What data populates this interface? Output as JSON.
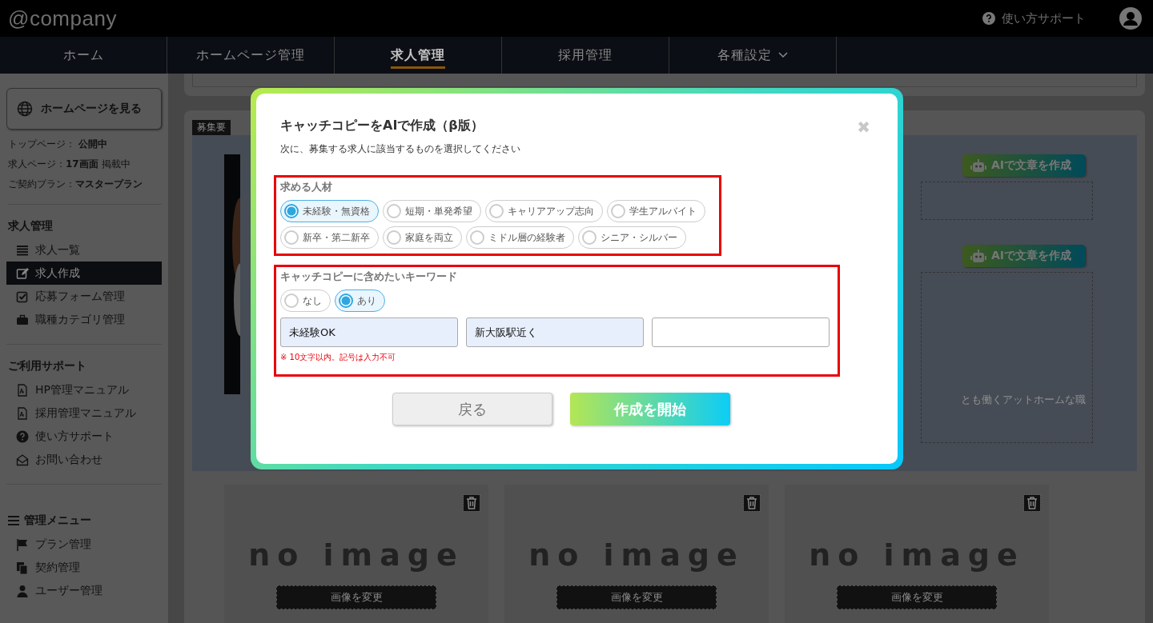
{
  "header": {
    "logo": "@company",
    "help_link": "使い方サポート"
  },
  "nav": {
    "tabs": [
      {
        "label": "ホーム",
        "selected": false
      },
      {
        "label": "ホームページ管理",
        "selected": false
      },
      {
        "label": "求人管理",
        "selected": true
      },
      {
        "label": "採用管理",
        "selected": false
      },
      {
        "label": "各種設定",
        "selected": false,
        "dropdown": true
      }
    ]
  },
  "sidebar": {
    "view_site_button": "ホームページを見る",
    "status": [
      "トップページ： **公開中**",
      "求人ページ：**17画面** 掲載中",
      "ご契約プラン：**マスタープラン**"
    ],
    "sections": [
      {
        "title": "求人管理",
        "items": [
          {
            "label": "求人一覧",
            "selected": false
          },
          {
            "label": "求人作成",
            "selected": true
          },
          {
            "label": "応募フォーム管理",
            "selected": false
          },
          {
            "label": "職種カテゴリ管理",
            "selected": false
          }
        ]
      },
      {
        "title": "ご利用サポート",
        "items": [
          {
            "label": "HP管理マニュアル",
            "selected": false
          },
          {
            "label": "採用管理マニュアル",
            "selected": false
          },
          {
            "label": "使い方サポート",
            "selected": false
          },
          {
            "label": "お問い合わせ",
            "selected": false
          }
        ]
      },
      {
        "title": "管理メニュー",
        "items": [
          {
            "label": "プラン管理",
            "selected": false
          },
          {
            "label": "契約管理",
            "selected": false
          },
          {
            "label": "ユーザー管理",
            "selected": false
          }
        ]
      }
    ]
  },
  "main": {
    "section_label": "募集要",
    "ai_buttons": [
      "AIで文章を作成",
      "AIで文章を作成"
    ],
    "description_text": "とも働くアットホームな職",
    "image_cards": [
      {
        "placeholder": "no image",
        "button": "画像を変更"
      },
      {
        "placeholder": "no image",
        "button": "画像を変更"
      },
      {
        "placeholder": "no image",
        "button": "画像を変更"
      }
    ]
  },
  "modal": {
    "title": "キャッチコピーをAIで作成（β版）",
    "subtitle": "次に、募集する求人に該当するものを選択してください",
    "close": "✖",
    "target_group": {
      "label": "求める人材",
      "options": [
        {
          "label": "未経験・無資格",
          "selected": true
        },
        {
          "label": "短期・単発希望",
          "selected": false
        },
        {
          "label": "キャリアアップ志向",
          "selected": false
        },
        {
          "label": "学生アルバイト",
          "selected": false
        },
        {
          "label": "新卒・第二新卒",
          "selected": false
        },
        {
          "label": "家庭を両立",
          "selected": false
        },
        {
          "label": "ミドル層の経験者",
          "selected": false
        },
        {
          "label": "シニア・シルバー",
          "selected": false
        }
      ]
    },
    "keyword_group": {
      "label": "キャッチコピーに含めたいキーワード",
      "options": [
        {
          "label": "なし",
          "selected": false
        },
        {
          "label": "あり",
          "selected": true
        }
      ],
      "fields": [
        {
          "filled": true,
          "value": "未経験OK"
        },
        {
          "filled": true,
          "value": "新大阪駅近く"
        },
        {
          "filled": false
        }
      ],
      "note": "※ 10文字以内。記号は入力不可"
    },
    "buttons": [
      {
        "kind": "secondary",
        "label": "戻る"
      },
      {
        "kind": "primary",
        "label": "作成を開始"
      }
    ]
  }
}
